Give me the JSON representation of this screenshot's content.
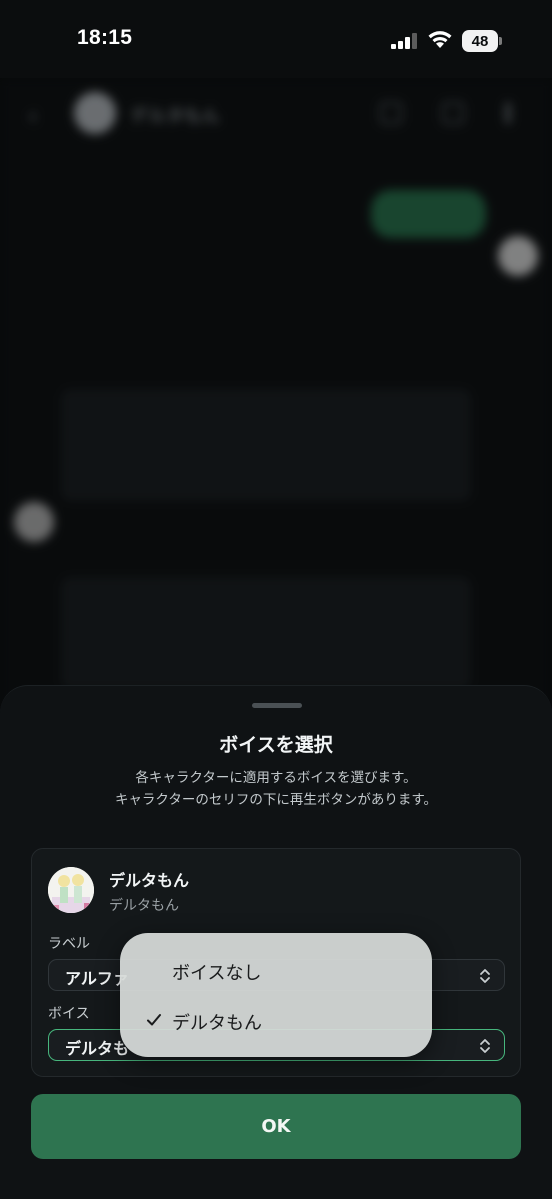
{
  "status_bar": {
    "time": "18:15",
    "battery": "48",
    "icons": [
      "signal-icon",
      "wifi-icon",
      "battery-icon"
    ]
  },
  "background_chat": {
    "header_title": "デルタもん",
    "icons": [
      "back-icon",
      "share-icon",
      "download-icon",
      "more-icon"
    ]
  },
  "sheet": {
    "title": "ボイスを選択",
    "description_line1": "各キャラクターに適用するボイスを選びます。",
    "description_line2": "キャラクターのセリフの下に再生ボタンがあります。",
    "character": {
      "name": "デルタもん",
      "subtitle": "デルタもん"
    },
    "label_field": {
      "label": "ラベル",
      "value": "アルファ"
    },
    "voice_field": {
      "label": "ボイス",
      "value": "デルタも"
    },
    "ok_label": "OK"
  },
  "dropdown": {
    "options": [
      {
        "label": "ボイスなし",
        "selected": false
      },
      {
        "label": "デルタもん",
        "selected": true
      }
    ]
  },
  "colors": {
    "accent": "#2e7450",
    "focus_border": "#47b67d",
    "sheet_bg": "#0f1214"
  }
}
